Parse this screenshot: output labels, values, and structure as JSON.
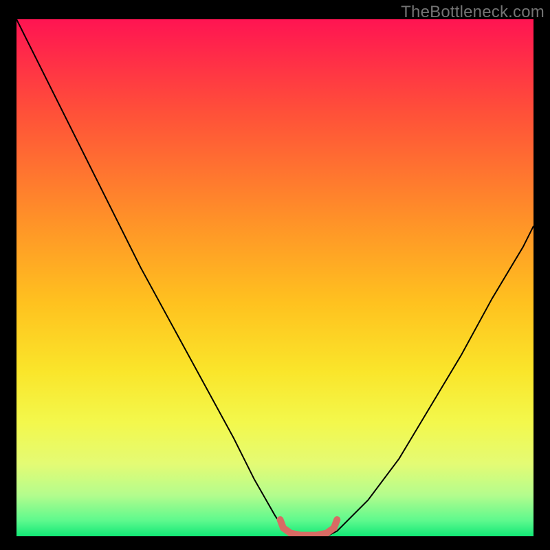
{
  "watermark": "TheBottleneck.com",
  "chart_data": {
    "type": "line",
    "title": "",
    "xlabel": "",
    "ylabel": "",
    "xlim": [
      0,
      100
    ],
    "ylim": [
      0,
      100
    ],
    "gradient_stops": [
      {
        "pct": 0,
        "color": "#ff1452"
      },
      {
        "pct": 18,
        "color": "#ff5039"
      },
      {
        "pct": 39,
        "color": "#ff9228"
      },
      {
        "pct": 55,
        "color": "#ffc21f"
      },
      {
        "pct": 68,
        "color": "#fae52a"
      },
      {
        "pct": 78,
        "color": "#f3f84c"
      },
      {
        "pct": 86,
        "color": "#e4fb74"
      },
      {
        "pct": 92,
        "color": "#b4fc8d"
      },
      {
        "pct": 97,
        "color": "#5df98d"
      },
      {
        "pct": 100,
        "color": "#12e876"
      }
    ],
    "series": [
      {
        "name": "bottleneck-curve",
        "color": "#000000",
        "width": 2,
        "x": [
          0,
          6,
          12,
          18,
          24,
          30,
          36,
          42,
          46,
          50,
          52,
          56,
          60,
          62,
          68,
          74,
          80,
          86,
          92,
          98,
          100
        ],
        "y": [
          100,
          88,
          76,
          64,
          52,
          41,
          30,
          19,
          11,
          4,
          1,
          0,
          0,
          1,
          7,
          15,
          25,
          35,
          46,
          56,
          60
        ]
      },
      {
        "name": "optimal-zone-marker",
        "color": "#d86b64",
        "width": 10,
        "linecap": "round",
        "x": [
          51.0,
          51.6,
          53.0,
          55.0,
          58.0,
          60.0,
          61.4,
          62.0
        ],
        "y": [
          3.2,
          1.6,
          0.6,
          0.2,
          0.2,
          0.6,
          1.6,
          3.2
        ]
      }
    ]
  }
}
